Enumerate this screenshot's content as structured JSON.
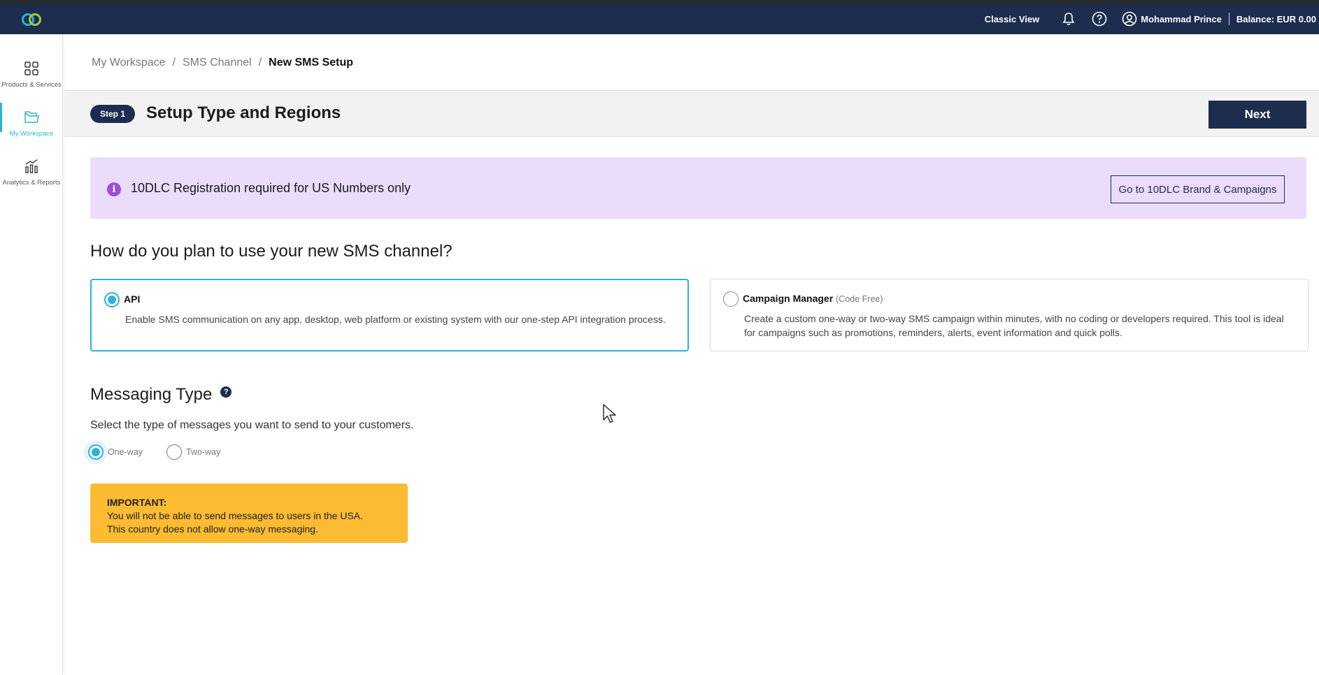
{
  "header": {
    "classic_view": "Classic View",
    "user_name": "Mohammad Prince",
    "balance": "Balance: EUR 0.00"
  },
  "sidebar": {
    "items": [
      {
        "label": "Products & Services",
        "icon": "grid-icon"
      },
      {
        "label": "My Workspace",
        "icon": "folder-icon",
        "active": true
      },
      {
        "label": "Analytics & Reports",
        "icon": "bar-chart-icon"
      }
    ]
  },
  "breadcrumb": {
    "items": [
      "My Workspace",
      "SMS Channel"
    ],
    "current": "New SMS Setup"
  },
  "step": {
    "badge": "Step 1",
    "title": "Setup Type and Regions",
    "next_label": "Next"
  },
  "banner": {
    "text": "10DLC Registration required for US Numbers only",
    "button": "Go to 10DLC Brand & Campaigns"
  },
  "usage": {
    "question": "How do you plan to use your new SMS channel?",
    "options": [
      {
        "title": "API",
        "tag": "",
        "description": "Enable SMS communication on any app, desktop, web platform or existing system with our one-step API integration process.",
        "selected": true
      },
      {
        "title": "Campaign Manager",
        "tag": "(Code Free)",
        "description": "Create a custom one-way or two-way SMS campaign within minutes, with no coding or developers required. This tool is ideal for campaigns such as promotions, reminders, alerts, event information and quick polls.",
        "selected": false
      }
    ]
  },
  "messaging": {
    "title": "Messaging Type",
    "help": "?",
    "description": "Select the type of messages you want to send to your customers.",
    "options": [
      {
        "label": "One-way",
        "selected": true
      },
      {
        "label": "Two-way",
        "selected": false
      }
    ]
  },
  "important": {
    "title": "IMPORTANT:",
    "line1": "You will not be able to send messages to users in the USA.",
    "line2": "This country does not allow one-way messaging."
  },
  "colors": {
    "navy": "#1d2d4e",
    "accent": "#2bb3d9",
    "banner_bg": "#ebdcfb",
    "info_purple": "#9b4fd6",
    "warning": "#fbbb33"
  }
}
